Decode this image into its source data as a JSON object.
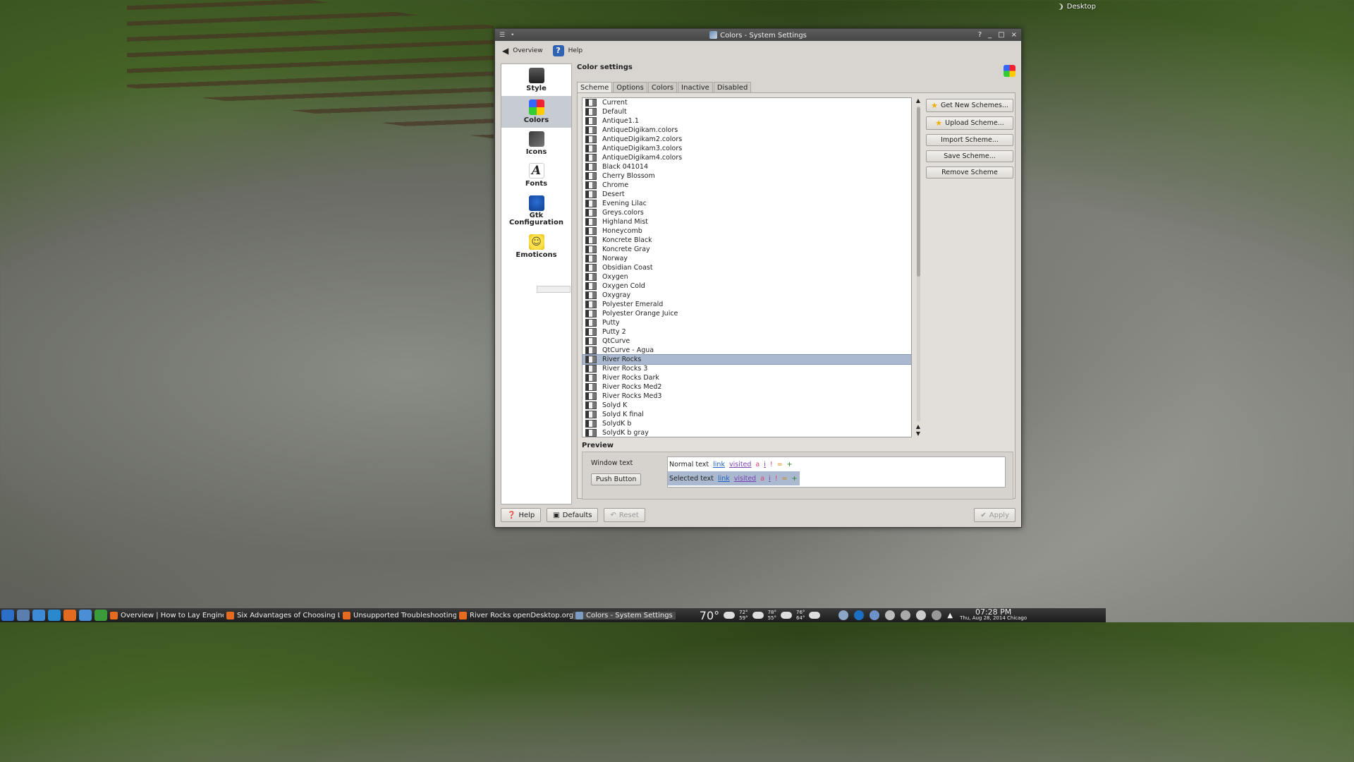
{
  "desktop": {
    "label": "Desktop"
  },
  "window": {
    "title": "Colors - System Settings",
    "controls": [
      "?",
      "_",
      "□",
      "×"
    ]
  },
  "toolbar": {
    "overview_label": "Overview",
    "help_label": "Help"
  },
  "sidebar": {
    "items": [
      {
        "label": "Style",
        "icon": "style-icon"
      },
      {
        "label": "Colors",
        "icon": "colors-icon"
      },
      {
        "label": "Icons",
        "icon": "icons-icon"
      },
      {
        "label": "Fonts",
        "icon": "fonts-icon"
      },
      {
        "label": "Gtk Configuration",
        "icon": "gtk-icon"
      },
      {
        "label": "Emoticons",
        "icon": "emoticons-icon"
      }
    ]
  },
  "main": {
    "title": "Color settings",
    "tabs": [
      "Scheme",
      "Options",
      "Colors",
      "Inactive",
      "Disabled"
    ],
    "active_tab": "Scheme",
    "schemes": [
      "Current",
      "Default",
      "Antique1.1",
      "AntiqueDigikam.colors",
      "AntiqueDigikam2.colors",
      "AntiqueDigikam3.colors",
      "AntiqueDigikam4.colors",
      "Black 041014",
      "Cherry Blossom",
      "Chrome",
      "Desert",
      "Evening Lilac",
      "Greys.colors",
      "Highland Mist",
      "Honeycomb",
      "Koncrete Black",
      "Koncrete Gray",
      "Norway",
      "Obsidian Coast",
      "Oxygen",
      "Oxygen Cold",
      "Oxygray",
      "Polyester Emerald",
      "Polyester Orange Juice",
      "Putty",
      "Putty 2",
      "QtCurve",
      "QtCurve - Agua",
      "River Rocks",
      "River Rocks 3",
      "River Rocks Dark",
      "River Rocks Med2",
      "River Rocks Med3",
      "Solyd K",
      "Solyd K final",
      "SolydK b",
      "SolydK b gray"
    ],
    "selected_scheme": "River Rocks",
    "buttons": {
      "get_new": "Get New Schemes...",
      "upload": "Upload Scheme...",
      "import": "Import Scheme...",
      "save": "Save Scheme...",
      "remove": "Remove Scheme"
    },
    "preview": {
      "title": "Preview",
      "window_text": "Window text",
      "push_button": "Push Button",
      "normal_text": "Normal text",
      "selected_text": "Selected text",
      "link": "link",
      "visited": "visited",
      "a": "a",
      "i": "i",
      "bang": "!",
      "eq": "=",
      "plus": "+"
    }
  },
  "bottom": {
    "help": "Help",
    "defaults": "Defaults",
    "reset": "Reset",
    "apply": "Apply"
  },
  "taskbar": {
    "tasks": [
      "Overview | How to Lay Engineer...",
      "Six Advantages of Choosing Lin...",
      "Unsupported Troubleshooting - ...",
      "River Rocks openDesktop.org - M...",
      "Colors - System Settings"
    ],
    "weather": {
      "current_temp": "70°",
      "day1_high": "72°",
      "day1_low": "59°",
      "day2_high": "78°",
      "day2_low": "55°",
      "day3_high": "76°",
      "day3_low": "64°"
    },
    "clock": {
      "time": "07:28 PM",
      "date": "Thu, Aug 28, 2014 Chicago"
    }
  },
  "colors": {
    "accent": "#aab9cf",
    "link": "#2060c0",
    "visited": "#7a3fb0"
  }
}
